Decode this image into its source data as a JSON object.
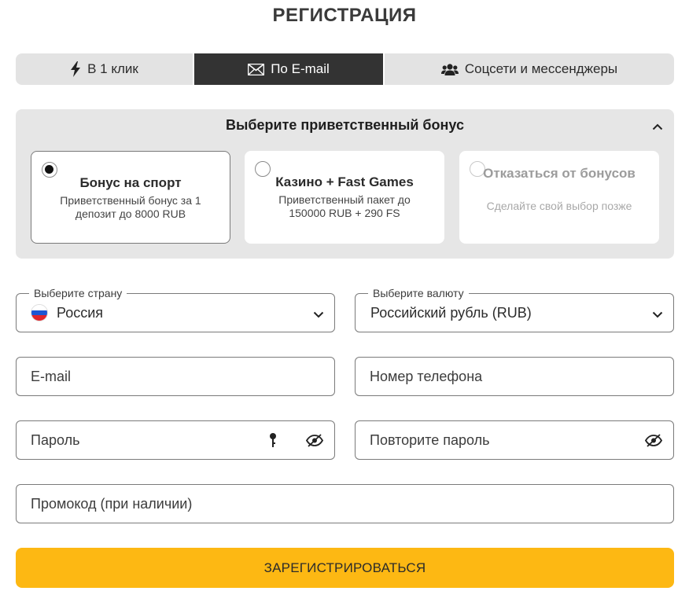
{
  "page": {
    "title": "РЕГИСТРАЦИЯ"
  },
  "tabs": [
    {
      "label": "В 1 клик",
      "icon": "lightning-icon",
      "active": false
    },
    {
      "label": "По E-mail",
      "icon": "envelope-icon",
      "active": true
    },
    {
      "label": "Соцсети и мессенджеры",
      "icon": "users-icon",
      "active": false
    }
  ],
  "bonus": {
    "heading": "Выберите приветственный бонус",
    "collapse_icon": "chevron-up-icon",
    "options": [
      {
        "title": "Бонус на спорт",
        "desc": "Приветственный бонус за 1 депозит до 8000 RUB",
        "selected": true
      },
      {
        "title": "Казино + Fast Games",
        "desc": "Приветственный пакет до 150000 RUB + 290 FS",
        "selected": false
      },
      {
        "title": "Отказаться от бонусов",
        "desc": "Сделайте свой выбор позже",
        "selected": false,
        "disabled": true
      }
    ]
  },
  "form": {
    "country": {
      "legend": "Выберите страну",
      "value": "Россия",
      "flag": "russia-flag-icon"
    },
    "currency": {
      "legend": "Выберите валюту",
      "value": "Российский рубль (RUB)"
    },
    "email": {
      "placeholder": "E-mail"
    },
    "phone": {
      "placeholder": "Номер телефона"
    },
    "password": {
      "placeholder": "Пароль"
    },
    "password_repeat": {
      "placeholder": "Повторите пароль"
    },
    "promo": {
      "placeholder": "Промокод (при наличии)"
    }
  },
  "submit": {
    "label": "ЗАРЕГИСТРИРОВАТЬСЯ"
  },
  "colors": {
    "accent": "#fdb813",
    "active_tab": "#333333",
    "panel_bg": "#e6e6e6"
  }
}
